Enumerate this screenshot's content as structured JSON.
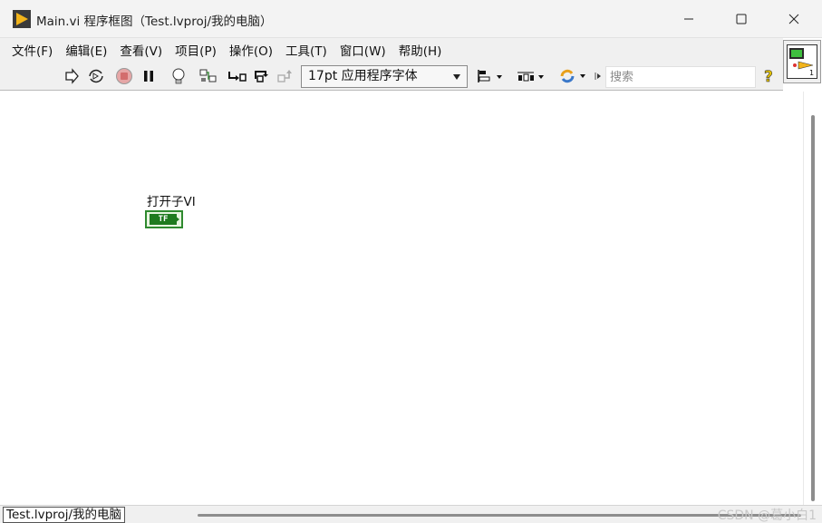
{
  "window": {
    "title": "Main.vi 程序框图（Test.lvproj/我的电脑）",
    "app_icon": "labview-blockdiagram-icon",
    "controls": [
      "minimize-icon",
      "maximize-icon",
      "close-icon"
    ]
  },
  "menu": {
    "items": [
      {
        "label": "文件(F)"
      },
      {
        "label": "编辑(E)"
      },
      {
        "label": "查看(V)"
      },
      {
        "label": "项目(P)"
      },
      {
        "label": "操作(O)"
      },
      {
        "label": "工具(T)"
      },
      {
        "label": "窗口(W)"
      },
      {
        "label": "帮助(H)"
      }
    ]
  },
  "toolbar": {
    "icons": [
      "run-arrow-icon",
      "run-continuously-icon",
      "abort-icon",
      "pause-icon",
      "highlight-execution-icon",
      "retain-wire-values-icon",
      "step-into-icon",
      "step-over-icon",
      "step-out-icon"
    ],
    "font": {
      "value": "17pt 应用程序字体"
    },
    "layout_icons": [
      "align-objects-icon",
      "distribute-objects-icon",
      "reorder-icon"
    ],
    "search": {
      "placeholder": "搜索"
    },
    "help_icon": "context-help-icon"
  },
  "diagram": {
    "terminal_label": "打开子VI",
    "terminal_type": "TF",
    "terminal_color": "#1f7a1f"
  },
  "status": {
    "path": "Test.lvproj/我的电脑",
    "watermark": "CSDN @葛小白1"
  }
}
